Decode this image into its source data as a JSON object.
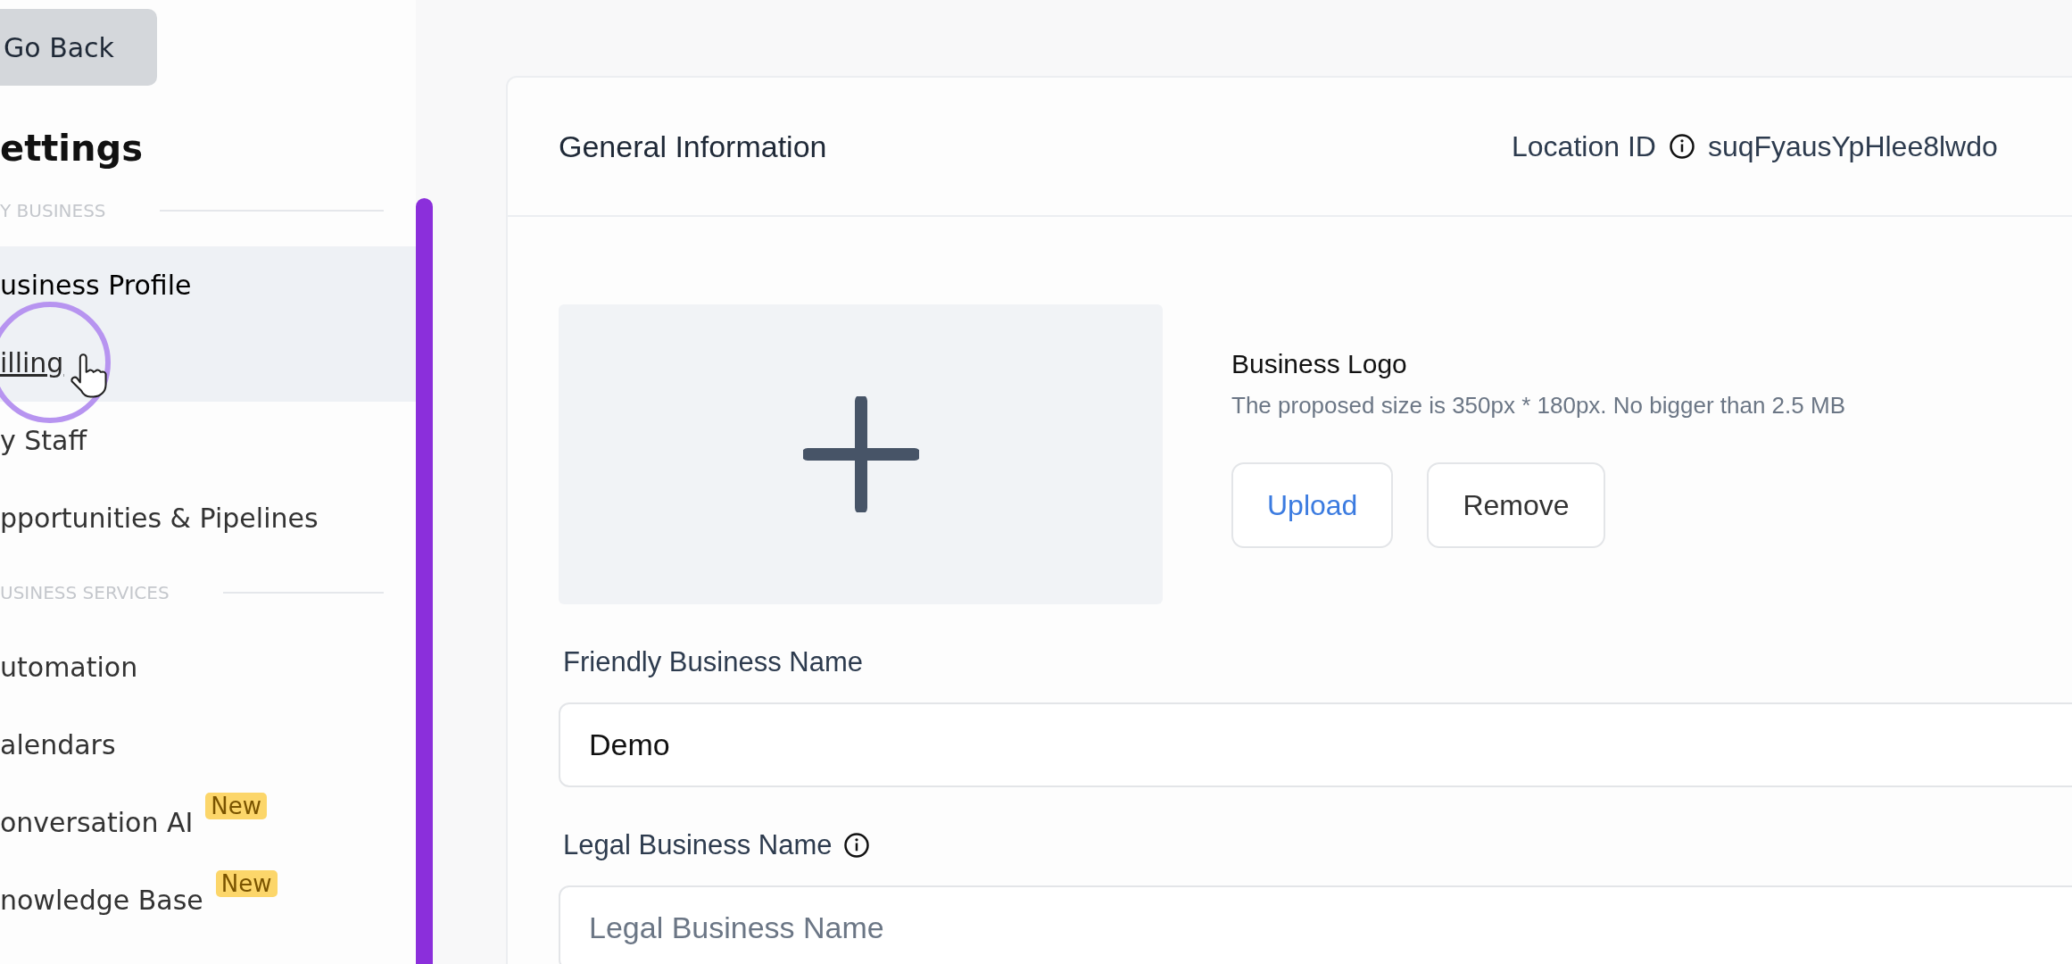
{
  "back_button": {
    "label": "Go Back"
  },
  "sidebar": {
    "title": "ettings",
    "sections": [
      {
        "label": "Y BUSINESS",
        "items": [
          {
            "label": "usiness Profile",
            "selected": true,
            "hovered": false
          },
          {
            "label": "illing",
            "selected": false,
            "hovered": true
          },
          {
            "label": "y Staff",
            "selected": false,
            "hovered": false
          },
          {
            "label": "pportunities & Pipelines",
            "selected": false,
            "hovered": false
          }
        ]
      },
      {
        "label": "USINESS SERVICES",
        "items": [
          {
            "label": "utomation",
            "selected": false,
            "hovered": false
          },
          {
            "label": "alendars",
            "selected": false,
            "hovered": false
          },
          {
            "label": "onversation AI",
            "selected": false,
            "hovered": false,
            "badge": "New"
          },
          {
            "label": "nowledge Base",
            "selected": false,
            "hovered": false,
            "badge": "New"
          }
        ]
      }
    ]
  },
  "card": {
    "title": "General Information",
    "location_label": "Location ID",
    "location_id": "suqFyausYpHlee8lwdo",
    "logo": {
      "title": "Business Logo",
      "hint": "The proposed size is 350px * 180px. No bigger than 2.5 MB",
      "buttons": [
        {
          "label": "Upload",
          "kind": "primary"
        },
        {
          "label": "Remove",
          "kind": "plain"
        }
      ]
    },
    "fields": [
      {
        "label": "Friendly Business Name",
        "value": "Demo",
        "info": false
      },
      {
        "label": "Legal Business Name",
        "placeholder": "Legal Business Name",
        "info": true
      }
    ]
  }
}
